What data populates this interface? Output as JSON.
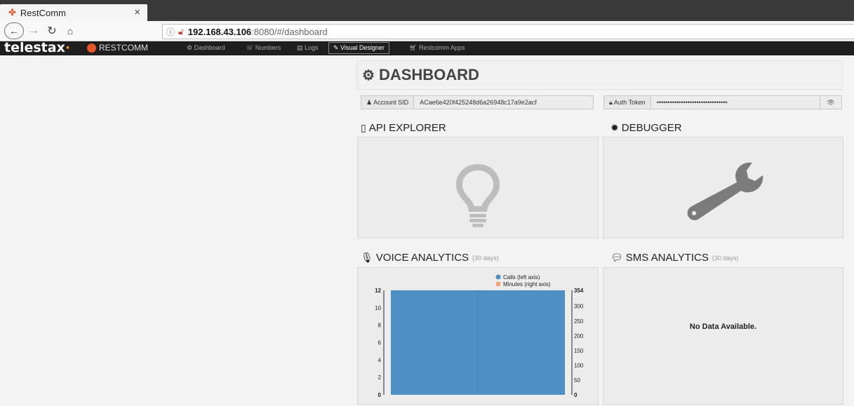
{
  "browser": {
    "tab_title": "RestComm",
    "close_glyph": "×",
    "url_host": "192.168.43.106",
    "url_rest": ":8080/#/dashboard"
  },
  "app": {
    "brand": "telestax",
    "brand_product": "RESTCOMM",
    "menu": [
      {
        "label": "Dashboard",
        "icon": "dashboard-icon"
      },
      {
        "label": "Numbers",
        "icon": "phone-icon"
      },
      {
        "label": "Logs",
        "icon": "file-icon"
      },
      {
        "label": "Visual Designer",
        "icon": "pencil-icon"
      },
      {
        "label": "Restcomm Apps",
        "icon": "cart-icon"
      }
    ],
    "active_menu": "Visual Designer"
  },
  "dashboard": {
    "title": "DASHBOARD",
    "account_sid_label": "Account SID",
    "account_sid_value": "ACae6e420f425248d6a26948c17a9e2acf",
    "auth_token_label": "Auth Token",
    "auth_token_value": "••••••••••••••••••••••••••••••••",
    "api_explorer_title": "API EXPLORER",
    "debugger_title": "DEBUGGER",
    "voice_title": "VOICE ANALYTICS",
    "voice_sub": "(30 days)",
    "sms_title": "SMS ANALYTICS",
    "sms_sub": "(30 days)",
    "sms_no_data": "No Data Available."
  },
  "chart_data": {
    "type": "bar",
    "series": [
      {
        "name": "Calls (left axis)",
        "values": [
          12
        ],
        "color": "#4f90c4",
        "axis": "left"
      },
      {
        "name": "Minutes (right axis)",
        "values": [],
        "color": "#f0a47a",
        "axis": "right"
      }
    ],
    "left_ylim": [
      0,
      12
    ],
    "right_ylim": [
      0,
      354
    ],
    "left_ticks": [
      "0",
      "2",
      "4",
      "6",
      "8",
      "10",
      "12"
    ],
    "right_ticks": [
      "0",
      "50",
      "100",
      "150",
      "200",
      "250",
      "300",
      "354"
    ],
    "legend_position": "top-right",
    "grid": false
  },
  "colors": {
    "calls": "#4f90c4",
    "minutes": "#f0a47a",
    "brand_orange": "#e8552a"
  }
}
